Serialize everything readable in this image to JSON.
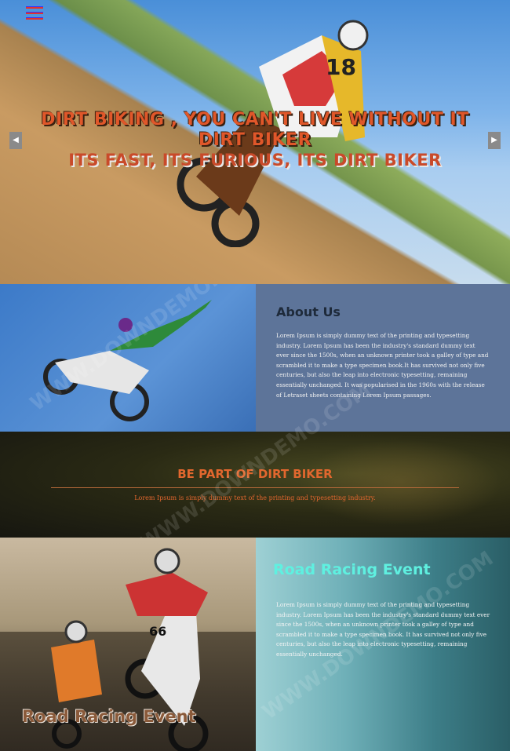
{
  "hero": {
    "title_line1": "DIRT BIKING , YOU CAN'T LIVE WITHOUT IT",
    "title_line2": "DIRT BIKER",
    "subtitle": "ITS FAST, ITS FURIOUS, ITS DIRT BIKER",
    "prev_arrow": "◀",
    "next_arrow": "▶"
  },
  "about": {
    "title": "About Us",
    "text": "Lorem Ipsum is simply dummy text of the printing and typesetting industry. Lorem Ipsum has been the industry's standard dummy text ever since the 1500s, when an unknown printer took a galley of type and scrambled it to make a type specimen book.It has survived not only five centuries, but also the leap into electronic typesetting, remaining essentially unchanged. It was popularised in the 1960s with the release of Letraset sheets containing Lorem Ipsum passages."
  },
  "bepart": {
    "title": "BE PART OF DIRT BIKER",
    "text": "Lorem Ipsum is simply dummy text of the printing and typesetting industry."
  },
  "race": {
    "left_title": "Road Racing Event",
    "right_title": "Road Racing Event",
    "text": "Lorem Ipsum is simply dummy text of the printing and typesetting industry. Lorem Ipsum has been the industry's standard dummy text ever since the 1500s, when an unknown printer took a galley of type and scrambled it to make a type specimen book. It has survived not only five centuries, but also the leap into electronic typesetting, remaining essentially unchanged."
  },
  "watermark": "WWW.DOWNDEMO.COM",
  "colors": {
    "accent_orange": "#e2672e",
    "about_panel": "#5d7499",
    "race_title_cyan": "#5ff0e0"
  }
}
